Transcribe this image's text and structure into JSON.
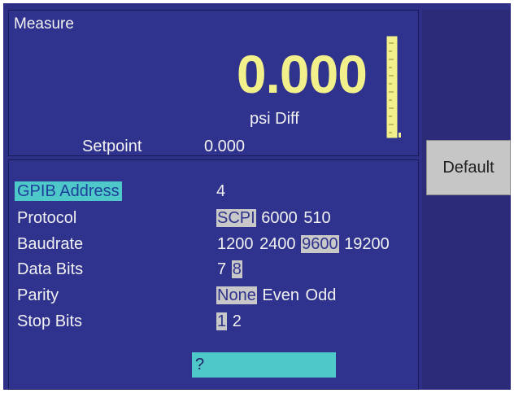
{
  "measure": {
    "label": "Measure",
    "value": "0.000",
    "unit": "psi Diff",
    "setpoint_label": "Setpoint",
    "setpoint_value": "0.000",
    "value_color": "#f2f08a"
  },
  "settings": {
    "gpib": {
      "label": "GPIB Address",
      "value": "4"
    },
    "protocol": {
      "label": "Protocol",
      "options": [
        "SCPI",
        "6000",
        "510"
      ],
      "selected": "SCPI"
    },
    "baudrate": {
      "label": "Baudrate",
      "options": [
        "1200",
        "2400",
        "9600",
        "19200"
      ],
      "selected": "9600"
    },
    "databits": {
      "label": "Data Bits",
      "options": [
        "7",
        "8"
      ],
      "selected": "8"
    },
    "parity": {
      "label": "Parity",
      "options": [
        "None",
        "Even",
        "Odd"
      ],
      "selected": "None"
    },
    "stopbits": {
      "label": "Stop Bits",
      "options": [
        "1",
        "2"
      ],
      "selected": "1"
    }
  },
  "input": {
    "value": "?"
  },
  "buttons": {
    "default_label": "Default"
  },
  "colors": {
    "background": "#2e3087",
    "highlight": "#4ec8c8",
    "selected_option": "#c8c8c8",
    "button": "#c6c6c6"
  }
}
